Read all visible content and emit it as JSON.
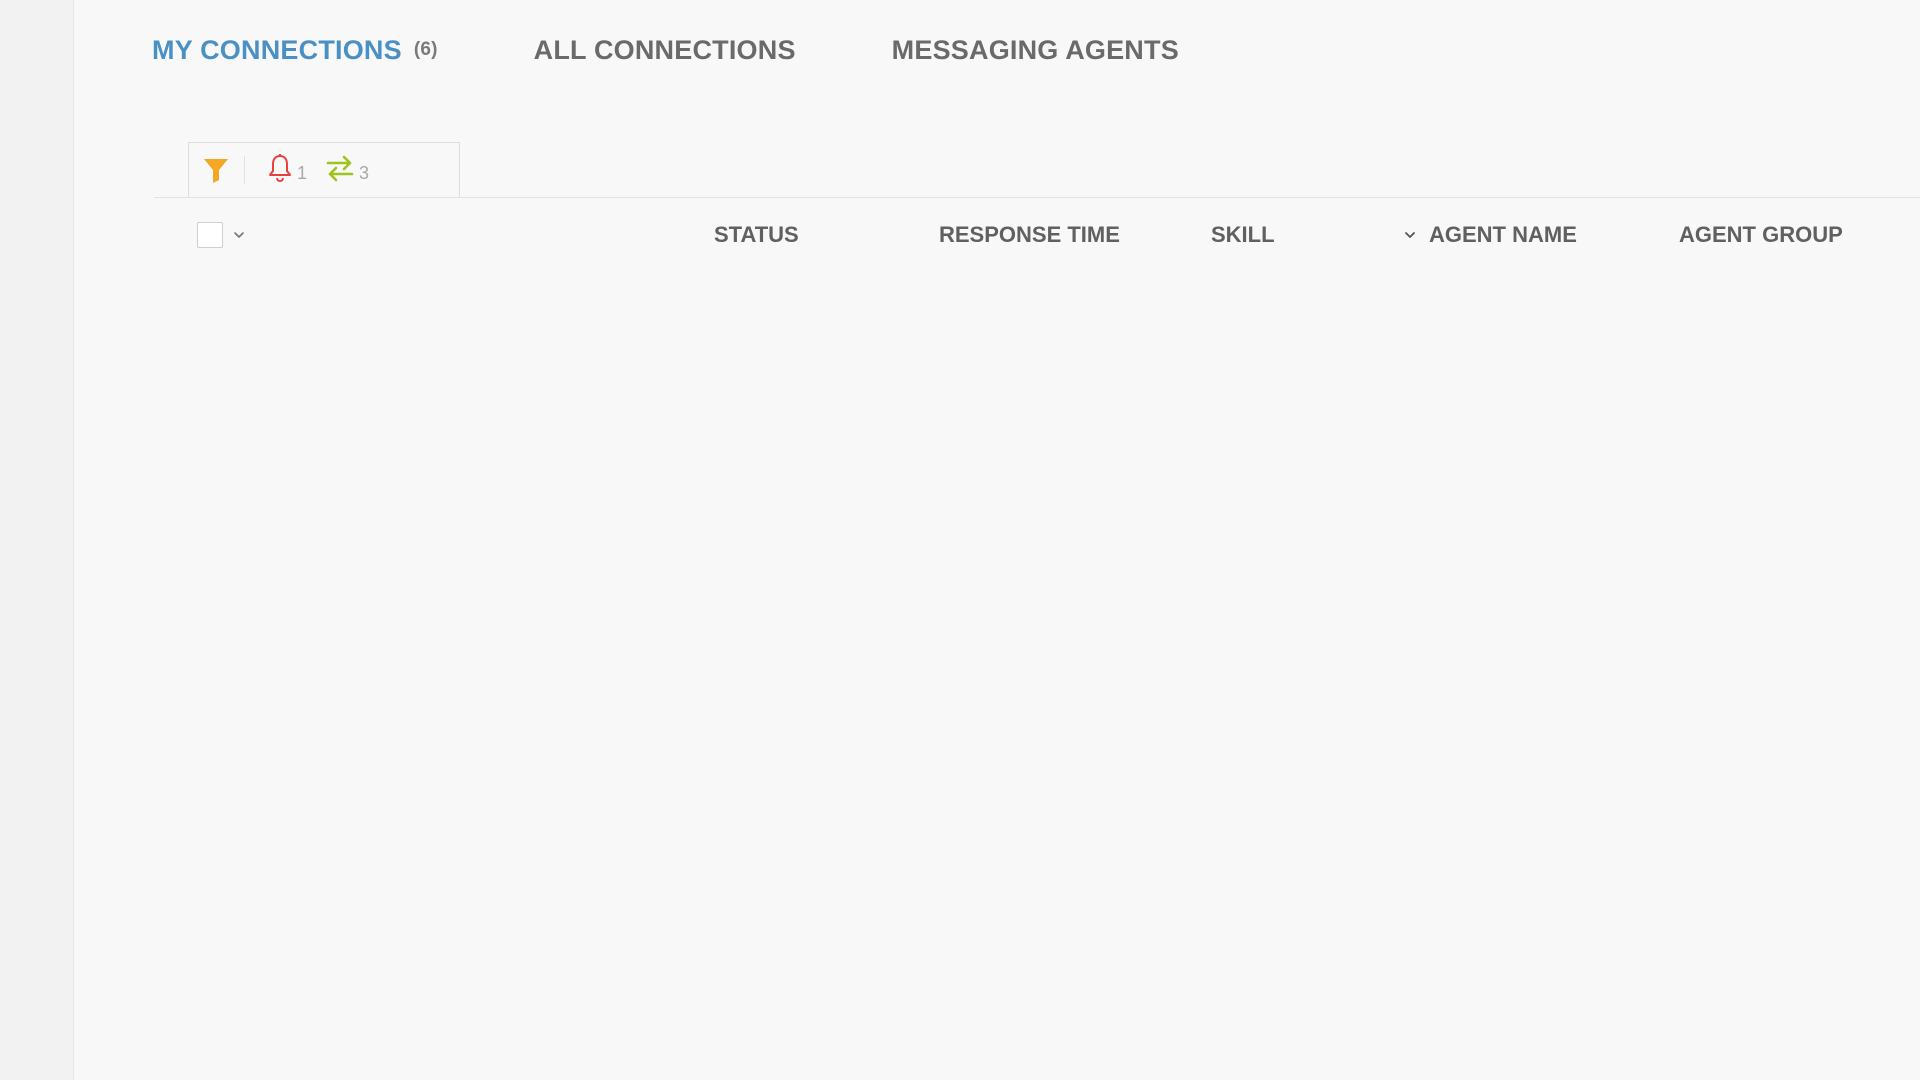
{
  "tabs": {
    "my_connections": {
      "label": "MY CONNECTIONS",
      "count": "(6)"
    },
    "all_connections": {
      "label": "ALL CONNECTIONS"
    },
    "messaging_agents": {
      "label": "MESSAGING AGENTS"
    },
    "active_tab": "my_connections"
  },
  "toolbar": {
    "filter_icon": "funnel-icon",
    "alerts": {
      "icon": "bell-icon",
      "count": "1"
    },
    "transfers": {
      "icon": "transfer-arrows-icon",
      "count": "3"
    }
  },
  "table": {
    "columns": [
      "STATUS",
      "RESPONSE TIME",
      "SKILL",
      "AGENT NAME",
      "AGENT GROUP"
    ],
    "sorted_column": "AGENT NAME",
    "sort_direction": "descending"
  },
  "colors": {
    "active_tab": "#4a90c4",
    "filter_icon": "#f5a623",
    "alert_icon": "#e8403a",
    "transfer_icon": "#9ec31c",
    "header_text": "#606060"
  }
}
